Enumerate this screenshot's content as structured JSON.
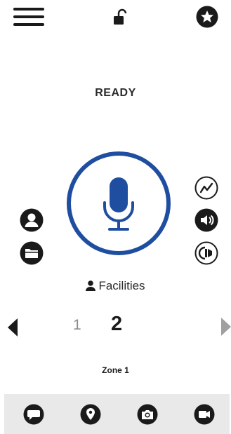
{
  "status": "READY",
  "channel": {
    "name": "Facilities",
    "previous": "1",
    "current": "2"
  },
  "zone": "Zone 1",
  "colors": {
    "accent": "#1f4ea1",
    "icon": "#1a1a1a",
    "bottom_bar": "#e9e9e9"
  },
  "icons": {
    "top": [
      "menu-icon",
      "unlock-icon",
      "star-icon"
    ],
    "left": [
      "user-icon",
      "folder-icon"
    ],
    "right": [
      "activity-icon",
      "speaker-icon",
      "tone-icon"
    ],
    "bottom": [
      "chat-icon",
      "location-icon",
      "camera-icon",
      "video-icon"
    ]
  }
}
